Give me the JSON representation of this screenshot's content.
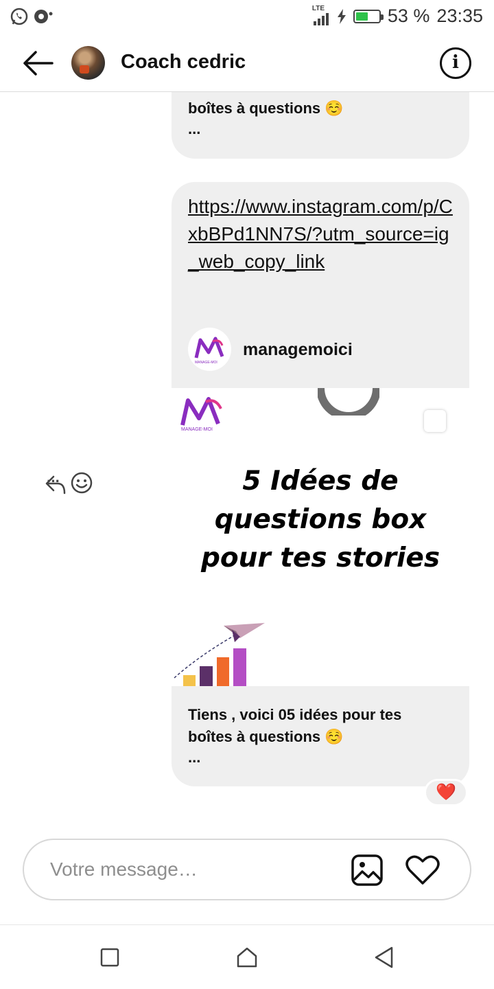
{
  "status_bar": {
    "network": "LTE",
    "battery": "53 %",
    "time": "23:35"
  },
  "header": {
    "contact_name": "Coach cedric",
    "info_icon": "i"
  },
  "messages": {
    "top_partial": {
      "line": "boîtes à questions ☺️",
      "ellipsis": "..."
    },
    "link_message": {
      "url": "https://www.instagram.com/p/CxbBPd1NN7S/?utm_source=ig_web_copy_link",
      "account": "managemoici",
      "logo_text": "MANAGE-MOI"
    },
    "post_preview": {
      "headline_1": "5 Idées de",
      "headline_2": "questions box",
      "headline_3": "pour tes stories",
      "caption_1": "Tiens , voici 05 idées pour tes",
      "caption_2": "boîtes à questions ☺️",
      "ellipsis": "...",
      "reaction": "❤️"
    },
    "actions": {
      "more": "···"
    }
  },
  "composer": {
    "placeholder": "Votre message…"
  }
}
